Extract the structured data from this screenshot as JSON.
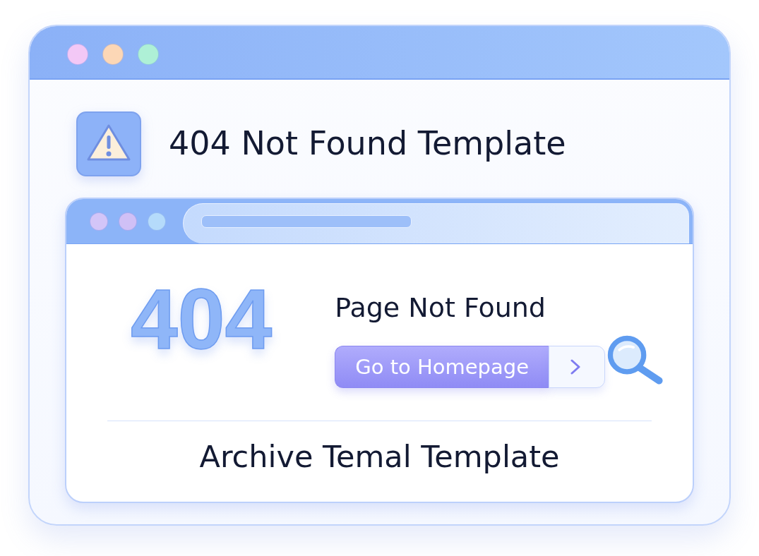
{
  "window": {
    "controls": [
      {
        "color": "#f3c8f6"
      },
      {
        "color": "#fcd7b6"
      },
      {
        "color": "#aef0d6"
      }
    ]
  },
  "header": {
    "title": "404 Not Found Template"
  },
  "browser": {
    "controls": [
      {
        "color": "#d3c5f8"
      },
      {
        "color": "#d0c0f6"
      },
      {
        "color": "#b5dbfb"
      }
    ],
    "error_code": "404",
    "heading": "Page Not Found",
    "button": {
      "label": "Go to Homepage"
    },
    "footer": "Archive Temal Template"
  }
}
